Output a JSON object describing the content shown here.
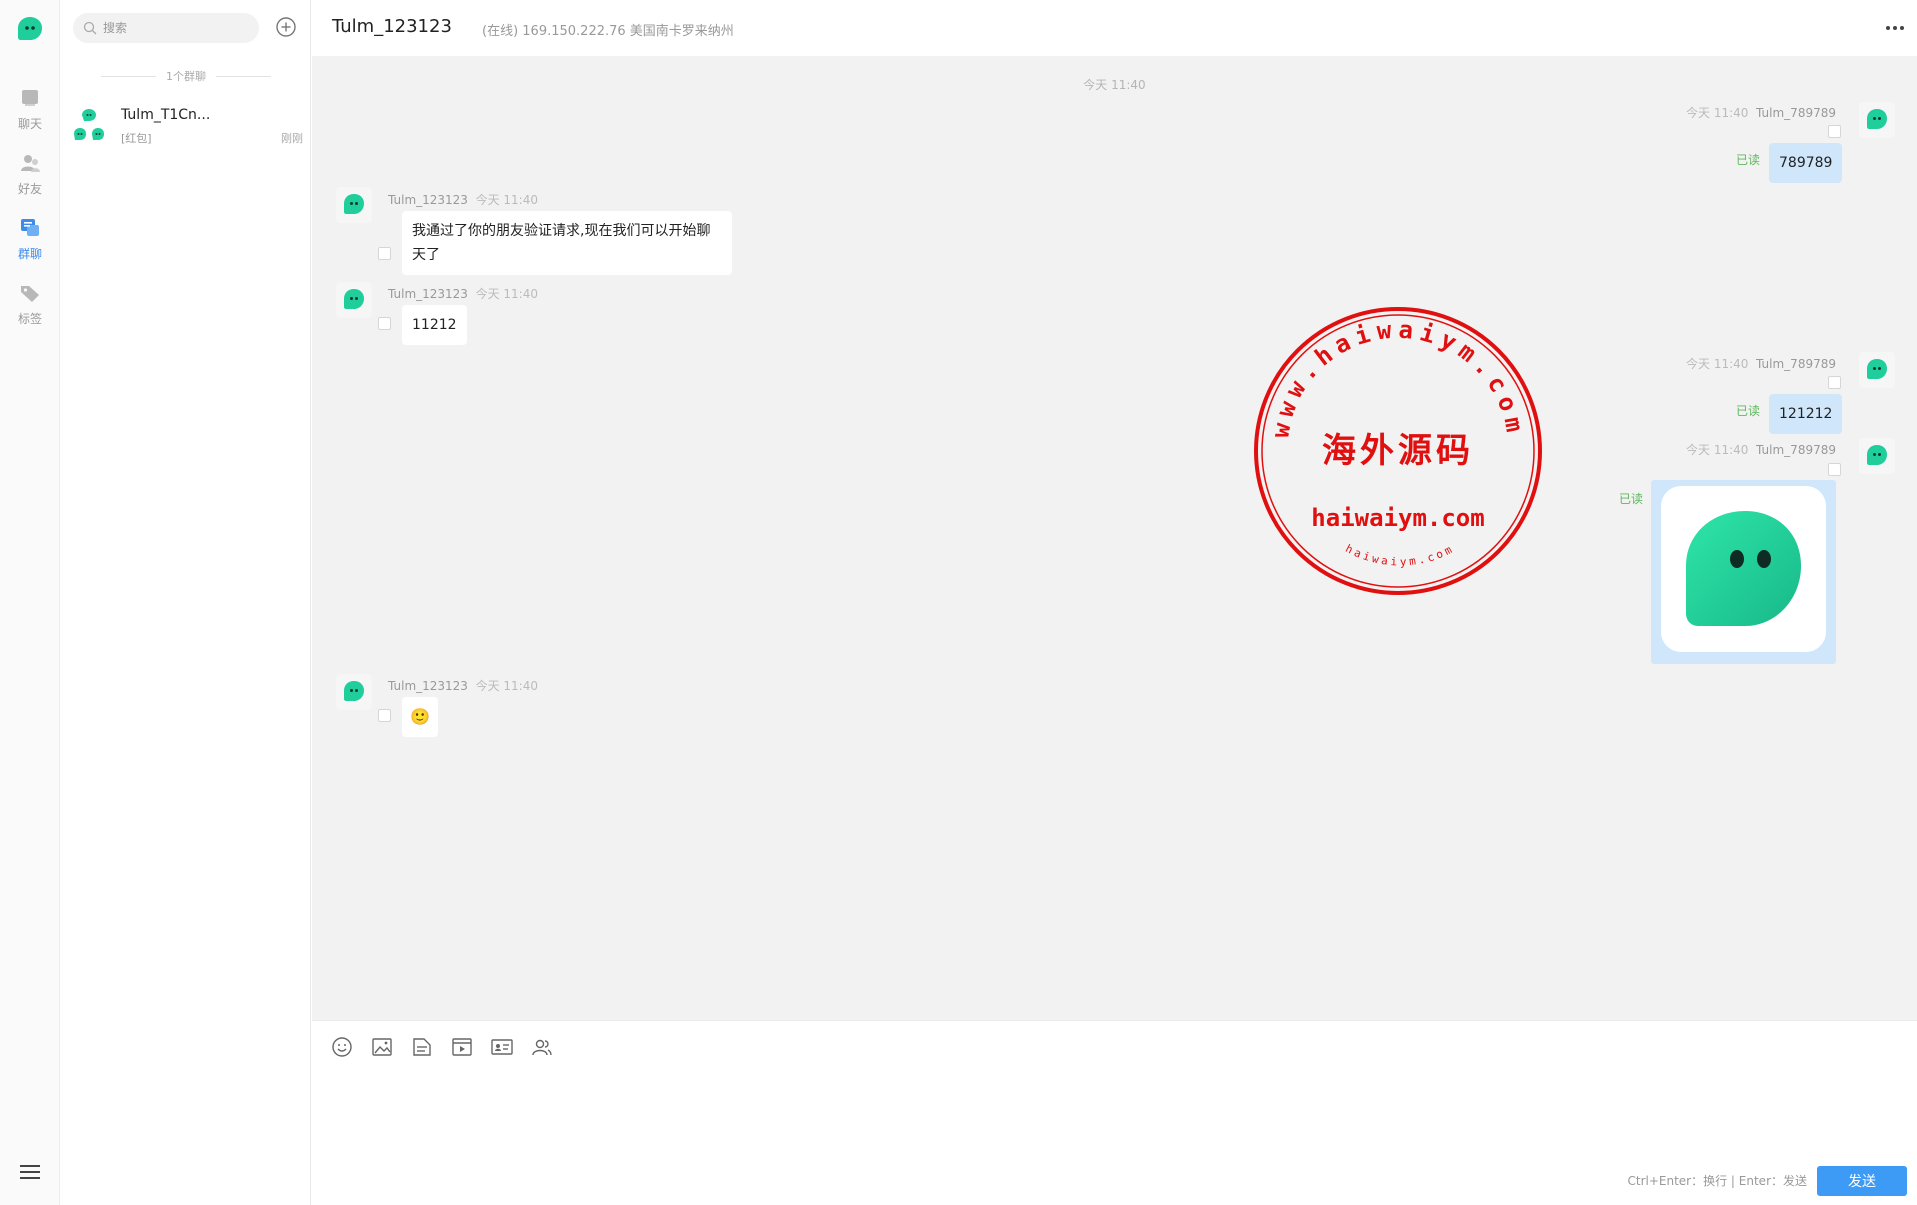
{
  "rail": {
    "items": [
      {
        "label": "聊天",
        "icon": "chat-icon",
        "active": false
      },
      {
        "label": "好友",
        "icon": "friends-icon",
        "active": false
      },
      {
        "label": "群聊",
        "icon": "group-chat-icon",
        "active": true
      },
      {
        "label": "标签",
        "icon": "tag-icon",
        "active": false
      }
    ]
  },
  "list": {
    "search_placeholder": "搜索",
    "group_count": "1个群聊",
    "chats": [
      {
        "name": "Tulm_T1Cn...",
        "preview": "[红包]",
        "time": "刚刚"
      }
    ]
  },
  "header": {
    "title": "Tulm_123123",
    "status": "(在线) 169.150.222.76 美国南卡罗来纳州"
  },
  "conversation": {
    "day_label": "今天 11:40",
    "messages": [
      {
        "sender": "Tulm_789789",
        "time": "今天 11:40",
        "text": "789789",
        "mine": true,
        "read": "已读"
      },
      {
        "sender": "Tulm_123123",
        "time": "今天 11:40",
        "text": "我通过了你的朋友验证请求,现在我们可以开始聊天了",
        "mine": false
      },
      {
        "sender": "Tulm_123123",
        "time": "今天 11:40",
        "text": "11212",
        "mine": false
      },
      {
        "sender": "Tulm_789789",
        "time": "今天 11:40",
        "text": "121212",
        "mine": true,
        "read": "已读"
      },
      {
        "sender": "Tulm_789789",
        "time": "今天 11:40",
        "text": "",
        "type": "image",
        "mine": true,
        "read": "已读"
      },
      {
        "sender": "Tulm_123123",
        "time": "今天 11:40",
        "text": "🙂",
        "type": "emoji",
        "mine": false
      }
    ]
  },
  "watermark": {
    "ring_text": "www.haiwaiym.com",
    "center": "海外源码",
    "domain": "haiwaiym.com",
    "small": "haiwaiym.com"
  },
  "composer": {
    "tools": [
      "emoji-icon",
      "image-icon",
      "file-icon",
      "video-icon",
      "card-icon",
      "contacts-icon"
    ],
    "hint": "Ctrl+Enter：换行 | Enter：发送",
    "send_label": "发送"
  },
  "colors": {
    "accent": "#3d9bf5",
    "brand_green": "#1fce9b",
    "my_bubble": "#cfe6fb",
    "read_green": "#5cb85c",
    "stamp_red": "#e01010"
  }
}
